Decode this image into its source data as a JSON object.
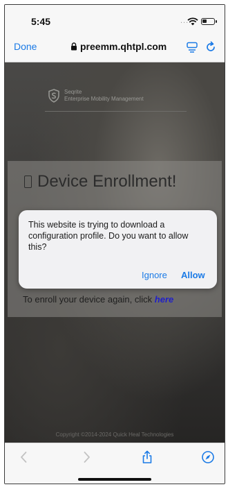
{
  "status_bar": {
    "time": "5:45",
    "signal_dots": "....",
    "icons": [
      "wifi-icon",
      "battery-icon"
    ]
  },
  "browser": {
    "done_label": "Done",
    "url": "preemm.qhtpl.com",
    "icons": [
      "lock-icon",
      "reader-icon",
      "reload-icon"
    ]
  },
  "page": {
    "brand_name": "Seqrite",
    "brand_tagline": "Enterprise Mobility Management",
    "title": "Device Enrollment!",
    "enroll_text": "To enroll your device again, click",
    "enroll_link": "here",
    "copyright": "Copyright ©2014-2024 Quick Heal Technologies"
  },
  "alert": {
    "message": "This website is trying to download a configuration profile. Do you want to allow this?",
    "ignore_label": "Ignore",
    "allow_label": "Allow"
  },
  "toolbar": {
    "icons": [
      "back-icon",
      "forward-icon",
      "share-icon",
      "compass-icon"
    ]
  },
  "colors": {
    "accent": "#1a7ae6",
    "link": "#2020c8",
    "overlay": "#3b3a38"
  }
}
